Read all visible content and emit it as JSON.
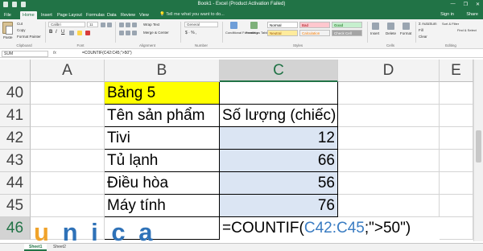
{
  "window": {
    "title": "Book1 - Excel (Product Activation Failed)",
    "minimize": "—",
    "restore": "❐",
    "close": "✕"
  },
  "ribbon": {
    "tabs": [
      "File",
      "Home",
      "Insert",
      "Page Layout",
      "Formulas",
      "Data",
      "Review",
      "View"
    ],
    "active_tab": "Home",
    "tell_me": "Tell me what you want to do...",
    "sign_in": "Sign in",
    "share": "Share",
    "clipboard": {
      "cut": "Cut",
      "copy": "Copy",
      "format_painter": "Format Painter",
      "paste": "Paste",
      "label": "Clipboard"
    },
    "font": {
      "name": "Calibri",
      "size": "11",
      "label": "Font"
    },
    "alignment": {
      "wrap": "Wrap Text",
      "merge": "Merge & Center",
      "label": "Alignment"
    },
    "number": {
      "format": "General",
      "label": "Number"
    },
    "styles": {
      "conditional": "Conditional Formatting",
      "format_as_table": "Format as Table",
      "normal": "Normal",
      "bad": "Bad",
      "good": "Good",
      "neutral": "Neutral",
      "calculation": "Calculation",
      "check_cell": "Check Cell",
      "label": "Styles"
    },
    "cells": {
      "insert": "Insert",
      "delete": "Delete",
      "format": "Format",
      "label": "Cells"
    },
    "editing": {
      "autosum": "AutoSum",
      "fill": "Fill",
      "clear": "Clear",
      "sort": "Sort & Filter",
      "find": "Find & Select",
      "label": "Editing"
    }
  },
  "formula_bar": {
    "name_box": "SUM",
    "fx": "fx",
    "formula": "=COUNTIF(C42:C45;\">50\")"
  },
  "columns": [
    "A",
    "B",
    "C",
    "D",
    "E"
  ],
  "rows": [
    {
      "num": "40",
      "b": "Bảng 5",
      "c": ""
    },
    {
      "num": "41",
      "b": "Tên sản phẩm",
      "c": "Số lượng (chiếc)"
    },
    {
      "num": "42",
      "b": "Tivi",
      "c": "12"
    },
    {
      "num": "43",
      "b": "Tủ lạnh",
      "c": "66"
    },
    {
      "num": "44",
      "b": "Điều hòa",
      "c": "56"
    },
    {
      "num": "45",
      "b": "Máy tính",
      "c": "76"
    },
    {
      "num": "46",
      "b": "",
      "c": ""
    }
  ],
  "active_cell": {
    "formula_start": "=COUNTIF(",
    "formula_ref": "C42:C45",
    "formula_end": ";\">50\")"
  },
  "sheets": [
    "Sheet1",
    "Sheet2"
  ],
  "watermark": {
    "letters": [
      "u",
      "n",
      "i",
      "c",
      "a"
    ]
  },
  "colors": {
    "excel_green": "#217346",
    "title_yellow": "#ffff00",
    "range_highlight": "#dbe5f3",
    "reference_blue": "#3a7cc2",
    "logo_orange": "#f0a32b",
    "logo_blue": "#2f72b8"
  }
}
